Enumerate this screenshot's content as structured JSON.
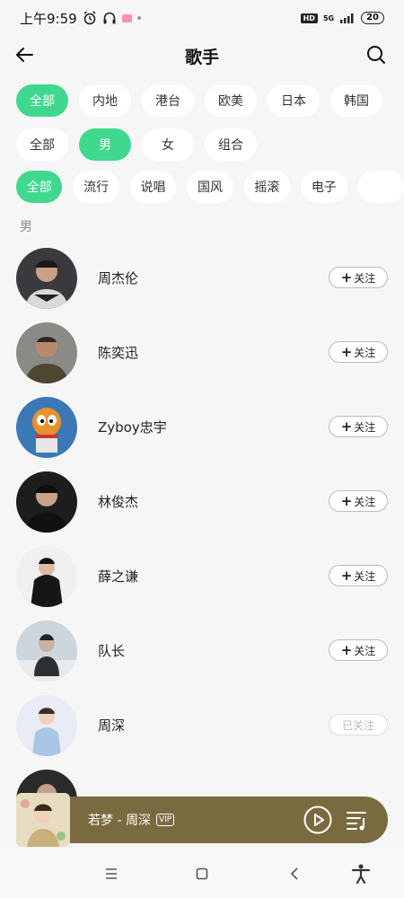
{
  "status_bar": {
    "time": "上午9:59",
    "network": "5G",
    "battery": "20"
  },
  "header": {
    "title": "歌手"
  },
  "filters": {
    "region": [
      {
        "label": "全部",
        "active": true
      },
      {
        "label": "内地",
        "active": false
      },
      {
        "label": "港台",
        "active": false
      },
      {
        "label": "欧美",
        "active": false
      },
      {
        "label": "日本",
        "active": false
      },
      {
        "label": "韩国",
        "active": false
      }
    ],
    "gender": [
      {
        "label": "全部",
        "active": false
      },
      {
        "label": "男",
        "active": true
      },
      {
        "label": "女",
        "active": false
      },
      {
        "label": "组合",
        "active": false
      }
    ],
    "genre": [
      {
        "label": "全部",
        "active": true
      },
      {
        "label": "流行",
        "active": false
      },
      {
        "label": "说唱",
        "active": false
      },
      {
        "label": "国风",
        "active": false
      },
      {
        "label": "摇滚",
        "active": false
      },
      {
        "label": "电子",
        "active": false
      }
    ]
  },
  "section_label": "男",
  "singers": [
    {
      "name": "周杰伦",
      "follow": "关注",
      "followed": false
    },
    {
      "name": "陈奕迅",
      "follow": "关注",
      "followed": false
    },
    {
      "name": "Zyboy忠宇",
      "follow": "关注",
      "followed": false
    },
    {
      "name": "林俊杰",
      "follow": "关注",
      "followed": false
    },
    {
      "name": "薛之谦",
      "follow": "关注",
      "followed": false
    },
    {
      "name": "队长",
      "follow": "关注",
      "followed": false
    },
    {
      "name": "周深",
      "follow": "已关注",
      "followed": true
    }
  ],
  "mini_player": {
    "song": "若梦 - 周深",
    "vip": "VIP"
  },
  "colors": {
    "accent": "#3fd88e",
    "player_bg": "#7a6a3f"
  }
}
